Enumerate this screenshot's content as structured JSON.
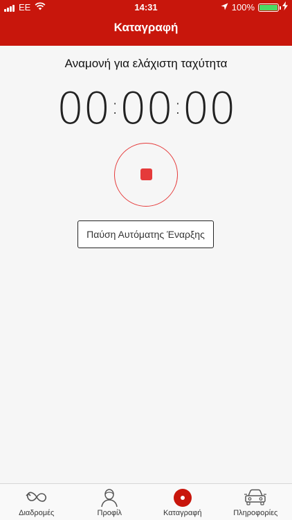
{
  "status_bar": {
    "carrier": "EE",
    "time": "14:31",
    "battery": "100%"
  },
  "header": {
    "title": "Καταγραφή"
  },
  "main": {
    "status_text": "Αναμονή για ελάχιστη ταχύτητα",
    "timer": {
      "hours": "00",
      "minutes": "00",
      "seconds": "00",
      "separator": ":"
    },
    "pause_button_label": "Παύση Αυτόματης Έναρξης"
  },
  "tabs": [
    {
      "label": "Διαδρομές",
      "icon": "routes-icon"
    },
    {
      "label": "Προφίλ",
      "icon": "profile-icon"
    },
    {
      "label": "Καταγραφή",
      "icon": "record-icon"
    },
    {
      "label": "Πληροφορίες",
      "icon": "car-icon"
    }
  ],
  "colors": {
    "brand": "#c8160c",
    "accent": "#e53a3a",
    "battery": "#4cd964"
  }
}
